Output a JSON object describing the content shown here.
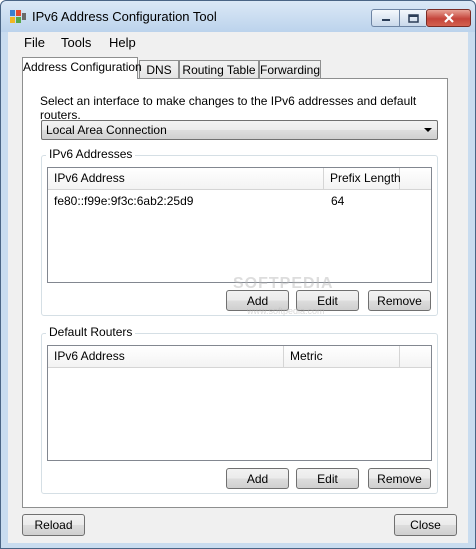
{
  "window": {
    "title": "IPv6 Address Configuration Tool"
  },
  "menu": [
    "File",
    "Tools",
    "Help"
  ],
  "tabs": [
    {
      "label": "Address Configuration",
      "active": true
    },
    {
      "label": "DNS",
      "active": false
    },
    {
      "label": "Routing Table",
      "active": false
    },
    {
      "label": "Forwarding",
      "active": false
    }
  ],
  "instruction": "Select an interface to make changes to the IPv6 addresses and default routers.",
  "interface_select": {
    "value": "Local Area Connection"
  },
  "ipv6_addresses": {
    "title": "IPv6 Addresses",
    "columns": [
      "IPv6 Address",
      "Prefix Length"
    ],
    "rows": [
      {
        "address": "fe80::f99e:9f3c:6ab2:25d9",
        "prefix": "64"
      }
    ],
    "buttons": {
      "add": "Add",
      "edit": "Edit",
      "remove": "Remove"
    }
  },
  "default_routers": {
    "title": "Default Routers",
    "columns": [
      "IPv6 Address",
      "Metric"
    ],
    "rows": [],
    "buttons": {
      "add": "Add",
      "edit": "Edit",
      "remove": "Remove"
    }
  },
  "footer": {
    "reload": "Reload",
    "close": "Close"
  },
  "watermark": {
    "text": "SOFTPEDIA",
    "url": "www.softpedia.com"
  },
  "colors": {
    "window_frame": "#c9dcef",
    "close_button": "#c5443a"
  }
}
